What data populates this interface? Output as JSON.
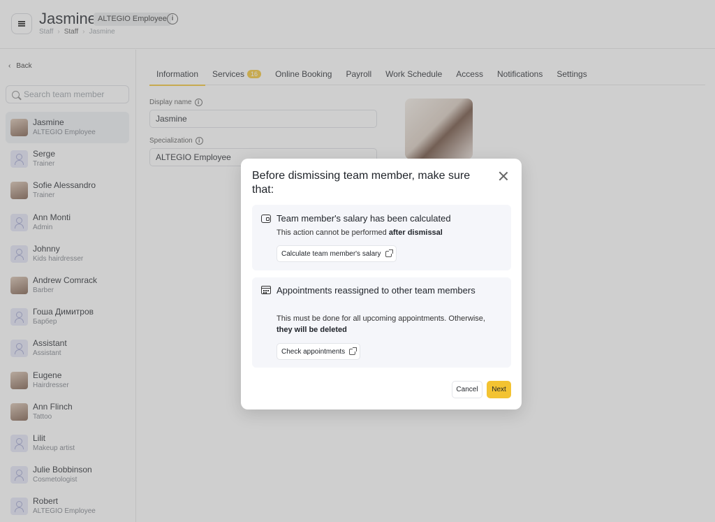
{
  "header": {
    "title": "Jasmine",
    "badge": "ALTEGIO Employee",
    "breadcrumb": [
      "Staff",
      "Staff",
      "Jasmine"
    ]
  },
  "sidebar": {
    "back_label": "Back",
    "search_placeholder": "Search team member",
    "staff": [
      {
        "name": "Jasmine",
        "role": "ALTEGIO Employee",
        "avatar": "photo"
      },
      {
        "name": "Serge",
        "role": "Trainer",
        "avatar": "placeholder"
      },
      {
        "name": "Sofie Alessandro",
        "role": "Trainer",
        "avatar": "photo"
      },
      {
        "name": "Ann Monti",
        "role": "Admin",
        "avatar": "placeholder"
      },
      {
        "name": "Johnny",
        "role": "Kids hairdresser",
        "avatar": "placeholder"
      },
      {
        "name": "Andrew Comrack",
        "role": "Barber",
        "avatar": "photo"
      },
      {
        "name": "Гоша Димитров",
        "role": "Барбер",
        "avatar": "placeholder"
      },
      {
        "name": "Assistant",
        "role": "Assistant",
        "avatar": "placeholder"
      },
      {
        "name": "Eugene",
        "role": "Hairdresser",
        "avatar": "photo"
      },
      {
        "name": "Ann Flinch",
        "role": "Tattoo",
        "avatar": "photo"
      },
      {
        "name": "Lilit",
        "role": "Makeup artist",
        "avatar": "placeholder"
      },
      {
        "name": "Julie Bobbinson",
        "role": "Cosmetologist",
        "avatar": "placeholder"
      },
      {
        "name": "Robert",
        "role": "ALTEGIO Employee",
        "avatar": "placeholder"
      }
    ]
  },
  "tabs": {
    "information": "Information",
    "services": "Services",
    "services_count": "16",
    "online_booking": "Online Booking",
    "payroll": "Payroll",
    "work_schedule": "Work Schedule",
    "access": "Access",
    "notifications": "Notifications",
    "settings": "Settings"
  },
  "form": {
    "display_name_label": "Display name",
    "display_name_value": "Jasmine",
    "specialization_label": "Specialization",
    "specialization_value": "ALTEGIO Employee"
  },
  "modal": {
    "title": "Before dismissing team member, make sure that:",
    "salary": {
      "title": "Team member's salary has been calculated",
      "desc_prefix": "This action cannot be performed ",
      "desc_bold": "after dismissal",
      "link": "Calculate team member's salary"
    },
    "appointments": {
      "title": "Appointments reassigned to other team members",
      "desc_prefix": "This must be done for all upcoming appointments. Otherwise, ",
      "desc_bold": "they will be deleted",
      "link": "Check appointments"
    },
    "cancel_label": "Cancel",
    "next_label": "Next"
  },
  "colors": {
    "accent": "#f3c332"
  }
}
